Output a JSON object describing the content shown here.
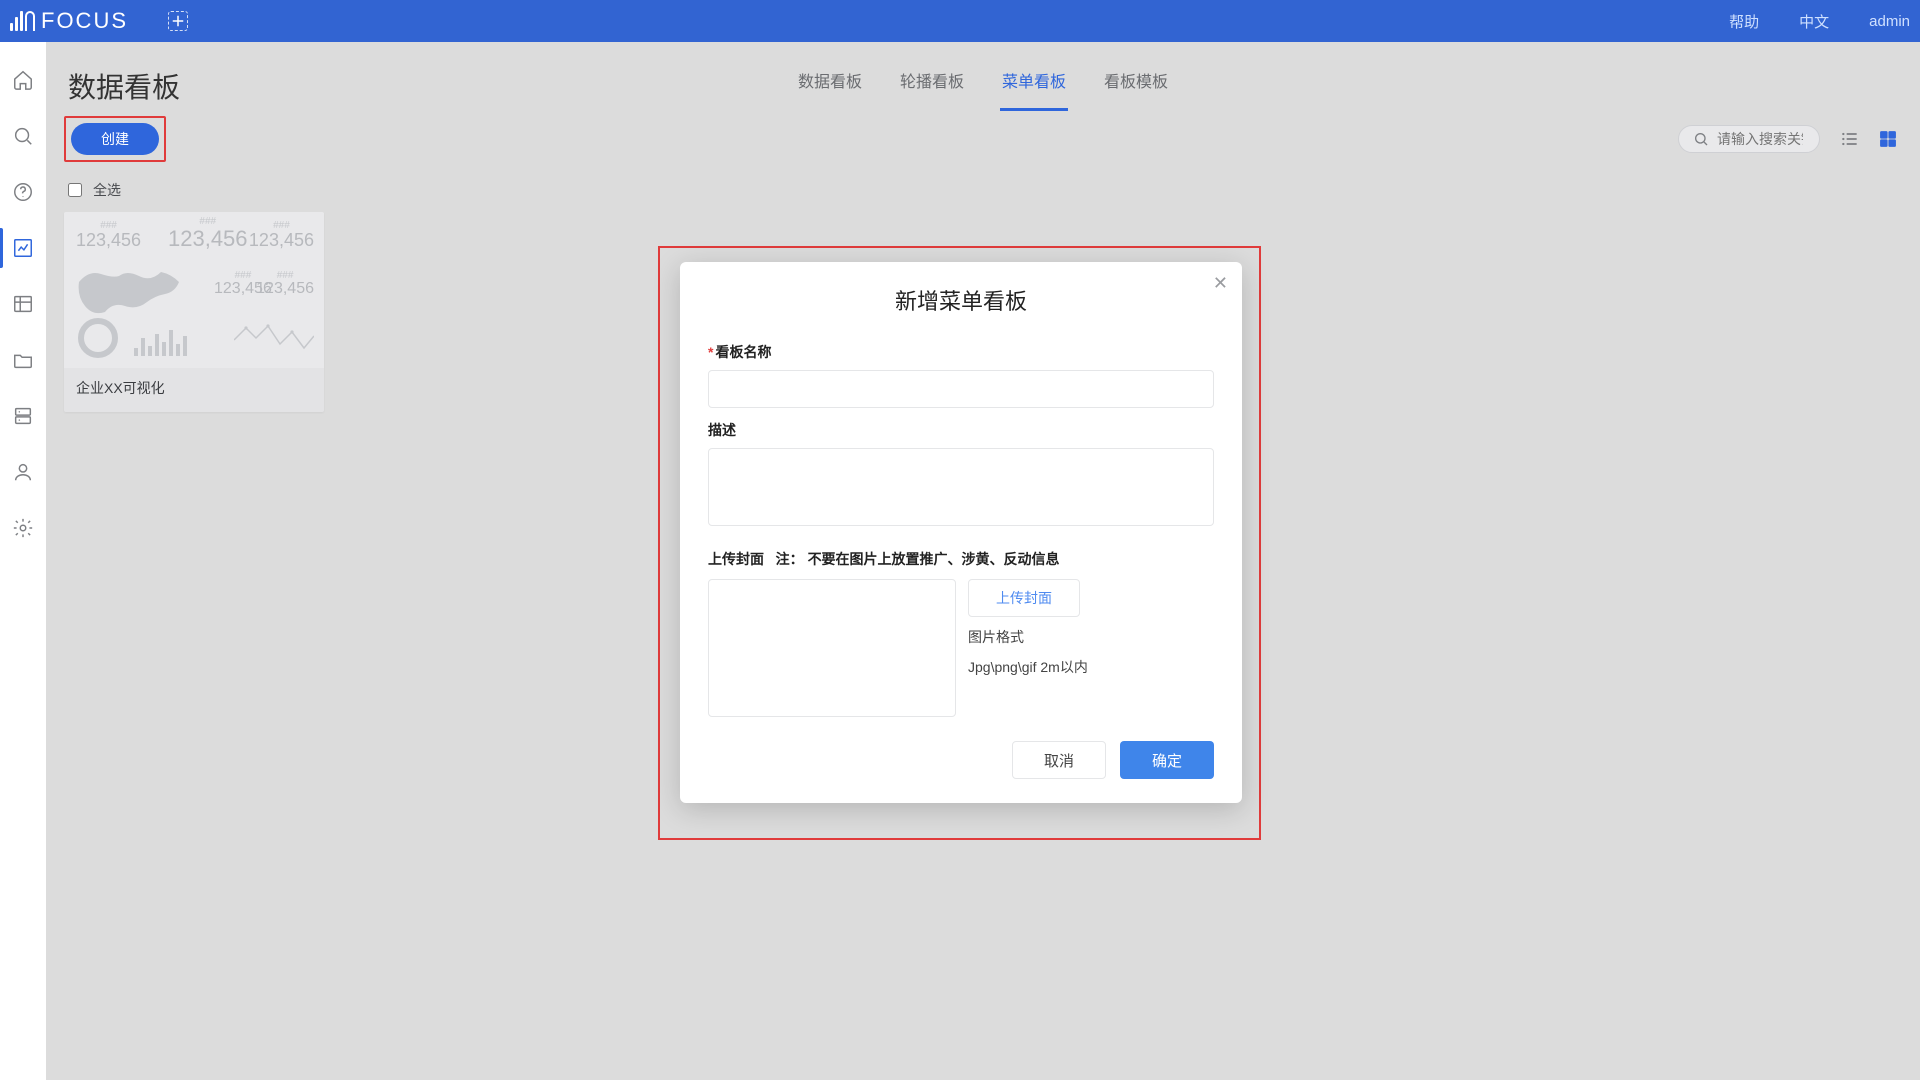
{
  "topbar": {
    "brand": "FOCUS",
    "help": "帮助",
    "lang": "中文",
    "user": "admin"
  },
  "page": {
    "title": "数据看板",
    "create": "创建",
    "select_all": "全选",
    "search_placeholder": "请输入搜索关键字"
  },
  "tabs": [
    "数据看板",
    "轮播看板",
    "菜单看板",
    "看板模板"
  ],
  "active_tab": 2,
  "card": {
    "caption": "企业XX可视化",
    "m1": "123,456",
    "m2": "123,456",
    "m3": "123,456",
    "m4": "123,456",
    "m5": "123,456"
  },
  "modal": {
    "title": "新增菜单看板",
    "name_label": "看板名称",
    "desc_label": "描述",
    "upload_section": "上传封面",
    "upload_note_prefix": "注：",
    "upload_note": "不要在图片上放置推广、涉黄、反动信息",
    "upload_btn": "上传封面",
    "fmt_label": "图片格式",
    "fmt_hint": "Jpg\\png\\gif 2m以内",
    "cancel": "取消",
    "ok": "确定"
  }
}
